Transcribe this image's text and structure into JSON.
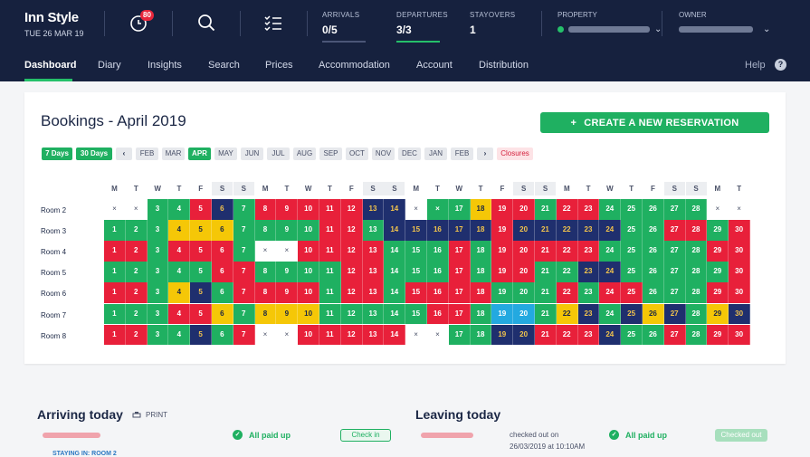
{
  "app": {
    "name": "Inn Style",
    "date": "TUE 26 MAR 19",
    "notification_count": "80"
  },
  "stats": [
    {
      "label": "ARRIVALS",
      "value": "0/5"
    },
    {
      "label": "DEPARTURES",
      "value": "3/3"
    },
    {
      "label": "STAYOVERS",
      "value": "1"
    }
  ],
  "property": {
    "label": "PROPERTY"
  },
  "owner": {
    "label": "OWNER"
  },
  "nav": [
    "Dashboard",
    "Diary",
    "Insights",
    "Search",
    "Prices",
    "Accommodation",
    "Account",
    "Distribution"
  ],
  "help": "Help",
  "bookings": {
    "title": "Bookings - April 2019",
    "new_reservation": "CREATE A NEW RESERVATION",
    "range_chips": [
      "7 Days",
      "30 Days"
    ],
    "months": [
      "FEB",
      "MAR",
      "APR",
      "MAY",
      "JUN",
      "JUL",
      "AUG",
      "SEP",
      "OCT",
      "NOV",
      "DEC",
      "JAN",
      "FEB"
    ],
    "active_month": "APR",
    "closures": "Closures",
    "weekdays": [
      "M",
      "T",
      "W",
      "T",
      "F",
      "S",
      "S",
      "M",
      "T",
      "W",
      "T",
      "F",
      "S",
      "S",
      "M",
      "T",
      "W",
      "T",
      "F",
      "S",
      "S",
      "M",
      "T",
      "W",
      "T",
      "F",
      "S",
      "S",
      "M",
      "T"
    ],
    "rooms": [
      "Room 2",
      "Room 3",
      "Room 4",
      "Room 5",
      "Room 6",
      "Room 7",
      "Room 8"
    ],
    "grid": [
      [
        "×",
        "×",
        "3",
        "4",
        "5",
        "6",
        "7",
        "8",
        "9",
        "10",
        "11",
        "12",
        "13",
        "14",
        "×",
        "×",
        "17",
        "18",
        "19",
        "20",
        "21",
        "22",
        "23",
        "24",
        "25",
        "26",
        "27",
        "28",
        "×",
        "×"
      ],
      [
        "1",
        "2",
        "3",
        "4",
        "5",
        "6",
        "7",
        "8",
        "9",
        "10",
        "11",
        "12",
        "13",
        "14",
        "15",
        "16",
        "17",
        "18",
        "19",
        "20",
        "21",
        "22",
        "23",
        "24",
        "25",
        "26",
        "27",
        "28",
        "29",
        "30"
      ],
      [
        "1",
        "2",
        "3",
        "4",
        "5",
        "6",
        "7",
        "×",
        "×",
        "10",
        "11",
        "12",
        "13",
        "14",
        "15",
        "16",
        "17",
        "18",
        "19",
        "20",
        "21",
        "22",
        "23",
        "24",
        "25",
        "26",
        "27",
        "28",
        "29",
        "30"
      ],
      [
        "1",
        "2",
        "3",
        "4",
        "5",
        "6",
        "7",
        "8",
        "9",
        "10",
        "11",
        "12",
        "13",
        "14",
        "15",
        "16",
        "17",
        "18",
        "19",
        "20",
        "21",
        "22",
        "23",
        "24",
        "25",
        "26",
        "27",
        "28",
        "29",
        "30"
      ],
      [
        "1",
        "2",
        "3",
        "4",
        "5",
        "6",
        "7",
        "8",
        "9",
        "10",
        "11",
        "12",
        "13",
        "14",
        "15",
        "16",
        "17",
        "18",
        "19",
        "20",
        "21",
        "22",
        "23",
        "24",
        "25",
        "26",
        "27",
        "28",
        "29",
        "30"
      ],
      [
        "1",
        "2",
        "3",
        "4",
        "5",
        "6",
        "7",
        "8",
        "9",
        "10",
        "11",
        "12",
        "13",
        "14",
        "15",
        "16",
        "17",
        "18",
        "19",
        "20",
        "21",
        "22",
        "23",
        "24",
        "25",
        "26",
        "27",
        "28",
        "29",
        "30"
      ],
      [
        "1",
        "2",
        "3",
        "4",
        "5",
        "6",
        "7",
        "×",
        "×",
        "10",
        "11",
        "12",
        "13",
        "14",
        "×",
        "×",
        "17",
        "18",
        "19",
        "20",
        "21",
        "22",
        "23",
        "24",
        "25",
        "26",
        "27",
        "28",
        "29",
        "30"
      ]
    ],
    "colors": [
      "eeggrngrrrrrnneggyrrgrrgggggee",
      "gggyyyggggrrgnnnnnrnnnnnggrrgr",
      "rrgrrrgeerrrrgggrgrrrrrgggggrr",
      "gggggrrggggrrgggrgrrggnngggggr",
      "rrgyngrrrrgrrgrrrrgggrgrrgggrr",
      "gggrrygyyygggggrrgccgyngnyngyn",
      "rrggngreerrrrreeggnnrrrnggrgrr"
    ]
  },
  "arriving": {
    "title": "Arriving today",
    "print": "PRINT",
    "paid": "All paid up",
    "check_in": "Check in",
    "staying": "STAYING IN: ROOM 2"
  },
  "leaving": {
    "title": "Leaving today",
    "checked_out": "checked out on",
    "checked_out_time": "26/03/2019 at 10:10AM",
    "paid": "All paid up",
    "checked_out_btn": "Checked out"
  }
}
